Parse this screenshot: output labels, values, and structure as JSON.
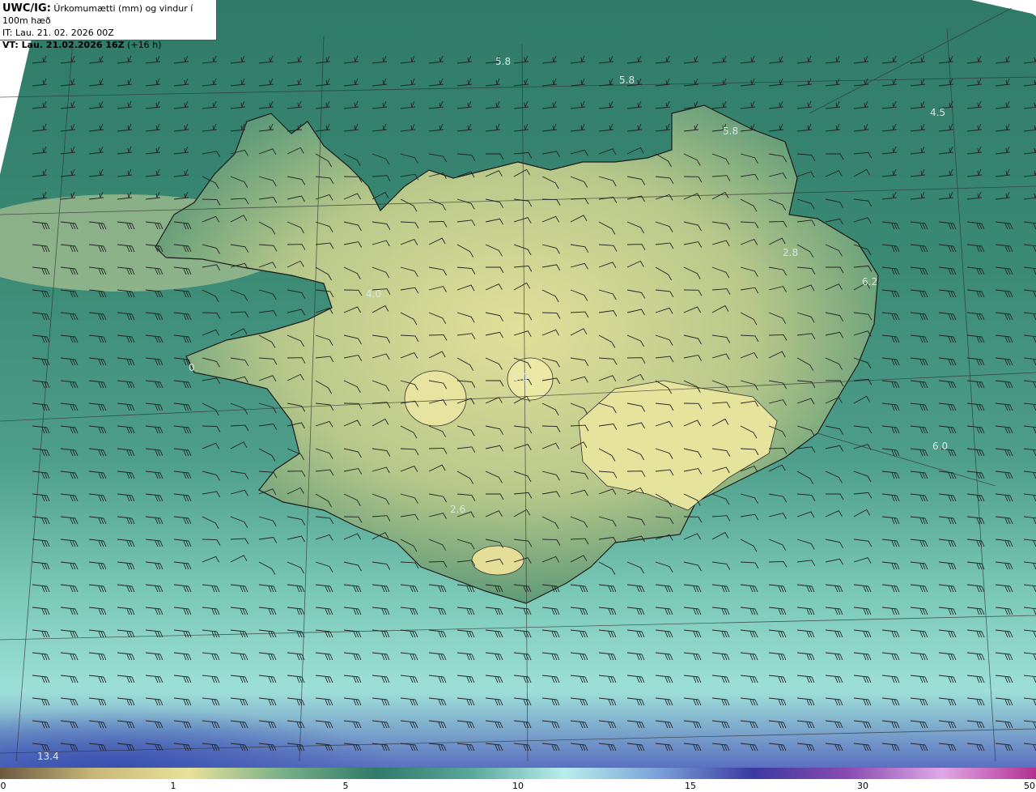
{
  "title": {
    "model": "UWC/IG:",
    "description": "Úrkomumætti (mm) og vindur í 100m hæð",
    "it_label": "IT:",
    "it_value": "Lau. 21. 02. 2026 00Z",
    "vt_label": "VT: Lau. 21.02.2026 16Z",
    "vt_offset": "(+16 h)"
  },
  "values": [
    {
      "text": "5.8",
      "name": "value-label-north-1"
    },
    {
      "text": "5.8",
      "name": "value-label-north-2"
    },
    {
      "text": "5.8",
      "name": "value-label-northeast"
    },
    {
      "text": "4.5",
      "name": "value-label-far-northeast"
    },
    {
      "text": "2.8",
      "name": "value-label-east"
    },
    {
      "text": "6.2",
      "name": "value-label-east-coast"
    },
    {
      "text": "4.0",
      "name": "value-label-west"
    },
    {
      "text": "0",
      "name": "value-label-reykjanes"
    },
    {
      "text": "1.0",
      "name": "value-label-central"
    },
    {
      "text": "6.0",
      "name": "value-label-southeast-sea"
    },
    {
      "text": "2.6",
      "name": "value-label-south"
    },
    {
      "text": "13.4",
      "name": "value-label-southwest-sea"
    }
  ],
  "colorbar": {
    "ticks": [
      "0",
      "1",
      "5",
      "10",
      "15",
      "30",
      "50"
    ],
    "colors": [
      "#6b5a40",
      "#c8b878",
      "#e8e29a",
      "#78b088",
      "#2f7a68",
      "#5aa89a",
      "#b8eeee",
      "#7aa0d8",
      "#3a3aa0",
      "#8a4ab0",
      "#e0a8e8",
      "#b03090"
    ]
  }
}
